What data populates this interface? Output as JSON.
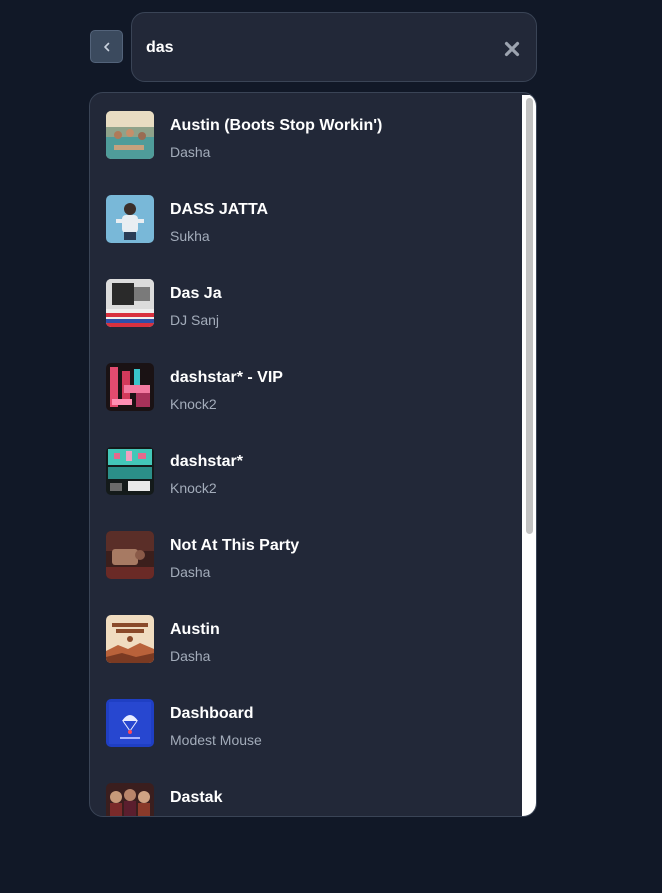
{
  "search": {
    "value": "das",
    "back_icon": "chevron-left-icon",
    "clear_icon": "close-icon"
  },
  "results": [
    {
      "title": "Austin (Boots Stop Workin')",
      "artist": "Dasha",
      "art": "pool party photo"
    },
    {
      "title": "DASS JATTA",
      "artist": "Sukha",
      "art": "man on blue background"
    },
    {
      "title": "Das Ja",
      "artist": "DJ Sanj",
      "art": "black and white with flag stripes"
    },
    {
      "title": "dashstar* - VIP",
      "artist": "Knock2",
      "art": "pink grid collage"
    },
    {
      "title": "dashstar*",
      "artist": "Knock2",
      "art": "teal grid collage"
    },
    {
      "title": "Not At This Party",
      "artist": "Dasha",
      "art": "dim red room"
    },
    {
      "title": "Austin",
      "artist": "Dasha",
      "art": "cowboy hats and cowgirl boots"
    },
    {
      "title": "Dashboard",
      "artist": "Modest Mouse",
      "art": "blue parachute"
    },
    {
      "title": "Dastak",
      "artist": "",
      "art": "group photo"
    }
  ],
  "colors": {
    "background": "#111827",
    "panel": "#222838",
    "panel_border": "#3a4456",
    "title_text": "#ffffff",
    "artist_text": "#a3acba",
    "back_button": "#3b4a5e"
  }
}
